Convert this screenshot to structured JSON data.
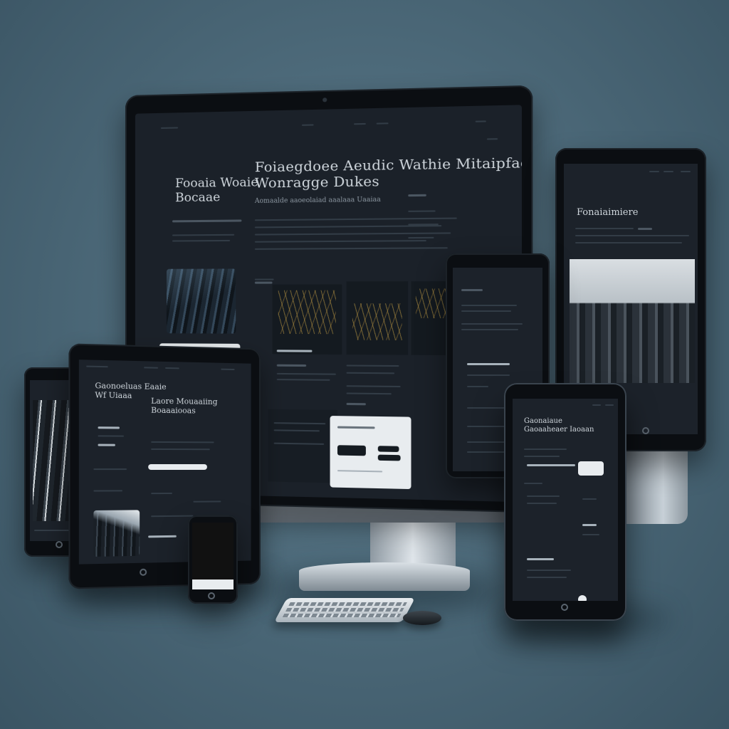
{
  "monitor": {
    "hero_title_left": "Fooaia Woaie\nBocaae",
    "hero_title_main": "Foiaegdoee Aeudic Wathie Mitaipfaoon\nWonragge Dukes",
    "hero_subtitle": "Aomaalde aaoeolaiad aaalaaa Uaaiaa"
  },
  "tablet_right": {
    "heading": "Fonaiaimiere"
  },
  "tablet_front": {
    "heading_left": "Gaonoeluas Eaaie\nWf Uiaaa",
    "heading_right": "Laore Mouaaiing\nBoaaaiooas"
  },
  "phone_front": {
    "heading": "Gaonaiaue\nGaoaaheaer Iaoaan"
  },
  "colors": {
    "background": "#4d6a7a",
    "screen": "#1c222a",
    "accent_white": "#e8ecef",
    "sketch_gold": "#c4a046"
  }
}
